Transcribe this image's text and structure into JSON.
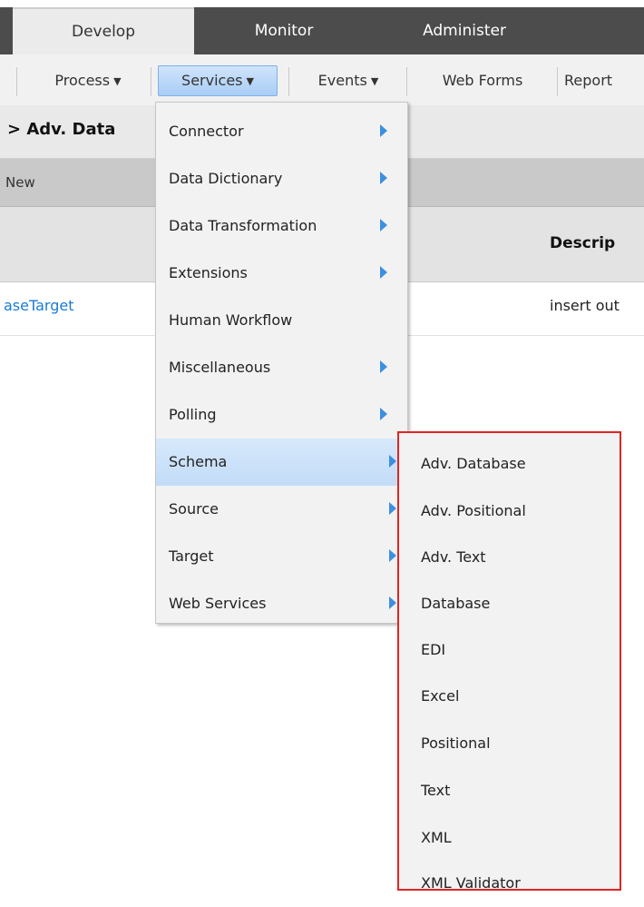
{
  "tabs": [
    "Develop",
    "Monitor",
    "Administer"
  ],
  "subnav": {
    "items": [
      "Process",
      "Services",
      "Events",
      "Web Forms",
      "Report"
    ]
  },
  "breadcrumb": "> Adv. Data",
  "toolbar": {
    "new_label": "New"
  },
  "table": {
    "header_desc": "Descrip",
    "row_link": "aseTarget",
    "row_desc": "insert out"
  },
  "services_menu": {
    "items": [
      {
        "label": "Connector",
        "submenu": true
      },
      {
        "label": "Data Dictionary",
        "submenu": true
      },
      {
        "label": "Data Transformation",
        "submenu": true
      },
      {
        "label": "Extensions",
        "submenu": true
      },
      {
        "label": "Human Workflow",
        "submenu": false
      },
      {
        "label": "Miscellaneous",
        "submenu": true
      },
      {
        "label": "Polling",
        "submenu": true
      },
      {
        "label": "Schema",
        "submenu": true
      },
      {
        "label": "Source",
        "submenu": true
      },
      {
        "label": "Target",
        "submenu": true
      },
      {
        "label": "Web Services",
        "submenu": true
      }
    ],
    "highlighted": "Schema"
  },
  "schema_submenu": {
    "items": [
      "Adv. Database",
      "Adv. Positional",
      "Adv. Text",
      "Database",
      "EDI",
      "Excel",
      "Positional",
      "Text",
      "XML",
      "XML Validator"
    ],
    "outline_color": "#e02424"
  },
  "colors": {
    "accent": "#3d8fe0",
    "link": "#1a7bd4",
    "tabbar": "#4c4c4c"
  }
}
